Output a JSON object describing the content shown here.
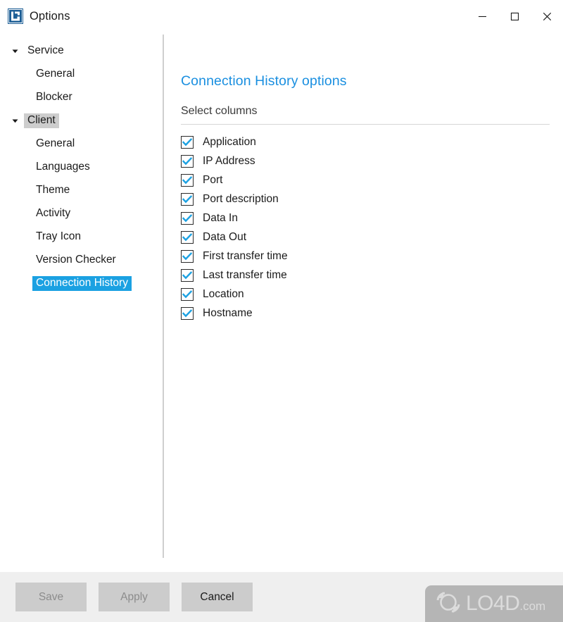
{
  "window": {
    "title": "Options",
    "app_icon": "app-logo-icon",
    "controls": [
      {
        "name": "minimize-button",
        "glyph": "minimize-icon",
        "label": "Minimize"
      },
      {
        "name": "maximize-button",
        "glyph": "maximize-icon",
        "label": "Maximize"
      },
      {
        "name": "close-button",
        "glyph": "close-icon",
        "label": "Close"
      }
    ]
  },
  "sidebar": {
    "items": [
      {
        "label": "Service",
        "level": 0,
        "expander": "chevron-down-icon",
        "state": "normal"
      },
      {
        "label": "General",
        "level": 1,
        "expander": "",
        "state": "normal"
      },
      {
        "label": "Blocker",
        "level": 1,
        "expander": "",
        "state": "normal"
      },
      {
        "label": "Client",
        "level": 0,
        "expander": "chevron-down-icon",
        "state": "selected-soft"
      },
      {
        "label": "General",
        "level": 1,
        "expander": "",
        "state": "normal"
      },
      {
        "label": "Languages",
        "level": 1,
        "expander": "",
        "state": "normal"
      },
      {
        "label": "Theme",
        "level": 1,
        "expander": "",
        "state": "normal"
      },
      {
        "label": "Activity",
        "level": 1,
        "expander": "",
        "state": "normal"
      },
      {
        "label": "Tray Icon",
        "level": 1,
        "expander": "",
        "state": "normal"
      },
      {
        "label": "Version Checker",
        "level": 1,
        "expander": "",
        "state": "normal"
      },
      {
        "label": "Connection History",
        "level": 1,
        "expander": "",
        "state": "selected-active"
      }
    ]
  },
  "content": {
    "title": "Connection History options",
    "group_label": "Select columns",
    "checkboxes": [
      {
        "label": "Application",
        "checked": true
      },
      {
        "label": "IP Address",
        "checked": true
      },
      {
        "label": "Port",
        "checked": true
      },
      {
        "label": "Port description",
        "checked": true
      },
      {
        "label": "Data In",
        "checked": true
      },
      {
        "label": "Data Out",
        "checked": true
      },
      {
        "label": "First transfer time",
        "checked": true
      },
      {
        "label": "Last transfer time",
        "checked": true
      },
      {
        "label": "Location",
        "checked": true
      },
      {
        "label": "Hostname",
        "checked": true
      }
    ]
  },
  "footer": {
    "buttons": [
      {
        "label": "Save",
        "name": "save-button",
        "enabled": false
      },
      {
        "label": "Apply",
        "name": "apply-button",
        "enabled": false
      },
      {
        "label": "Cancel",
        "name": "cancel-button",
        "enabled": true
      }
    ],
    "watermark": {
      "text": "LO4D",
      "suffix": ".com",
      "icon": "refresh-circle-icon"
    }
  },
  "colors": {
    "accent": "#1a8fe0",
    "selection": "#1ba1e2",
    "selection_soft": "#cdcdcd",
    "checkbox_check": "#1ba1e2",
    "footer_bg": "#efefef",
    "button_bg": "#cccccc",
    "watermark_bg": "#b5b5b5"
  }
}
